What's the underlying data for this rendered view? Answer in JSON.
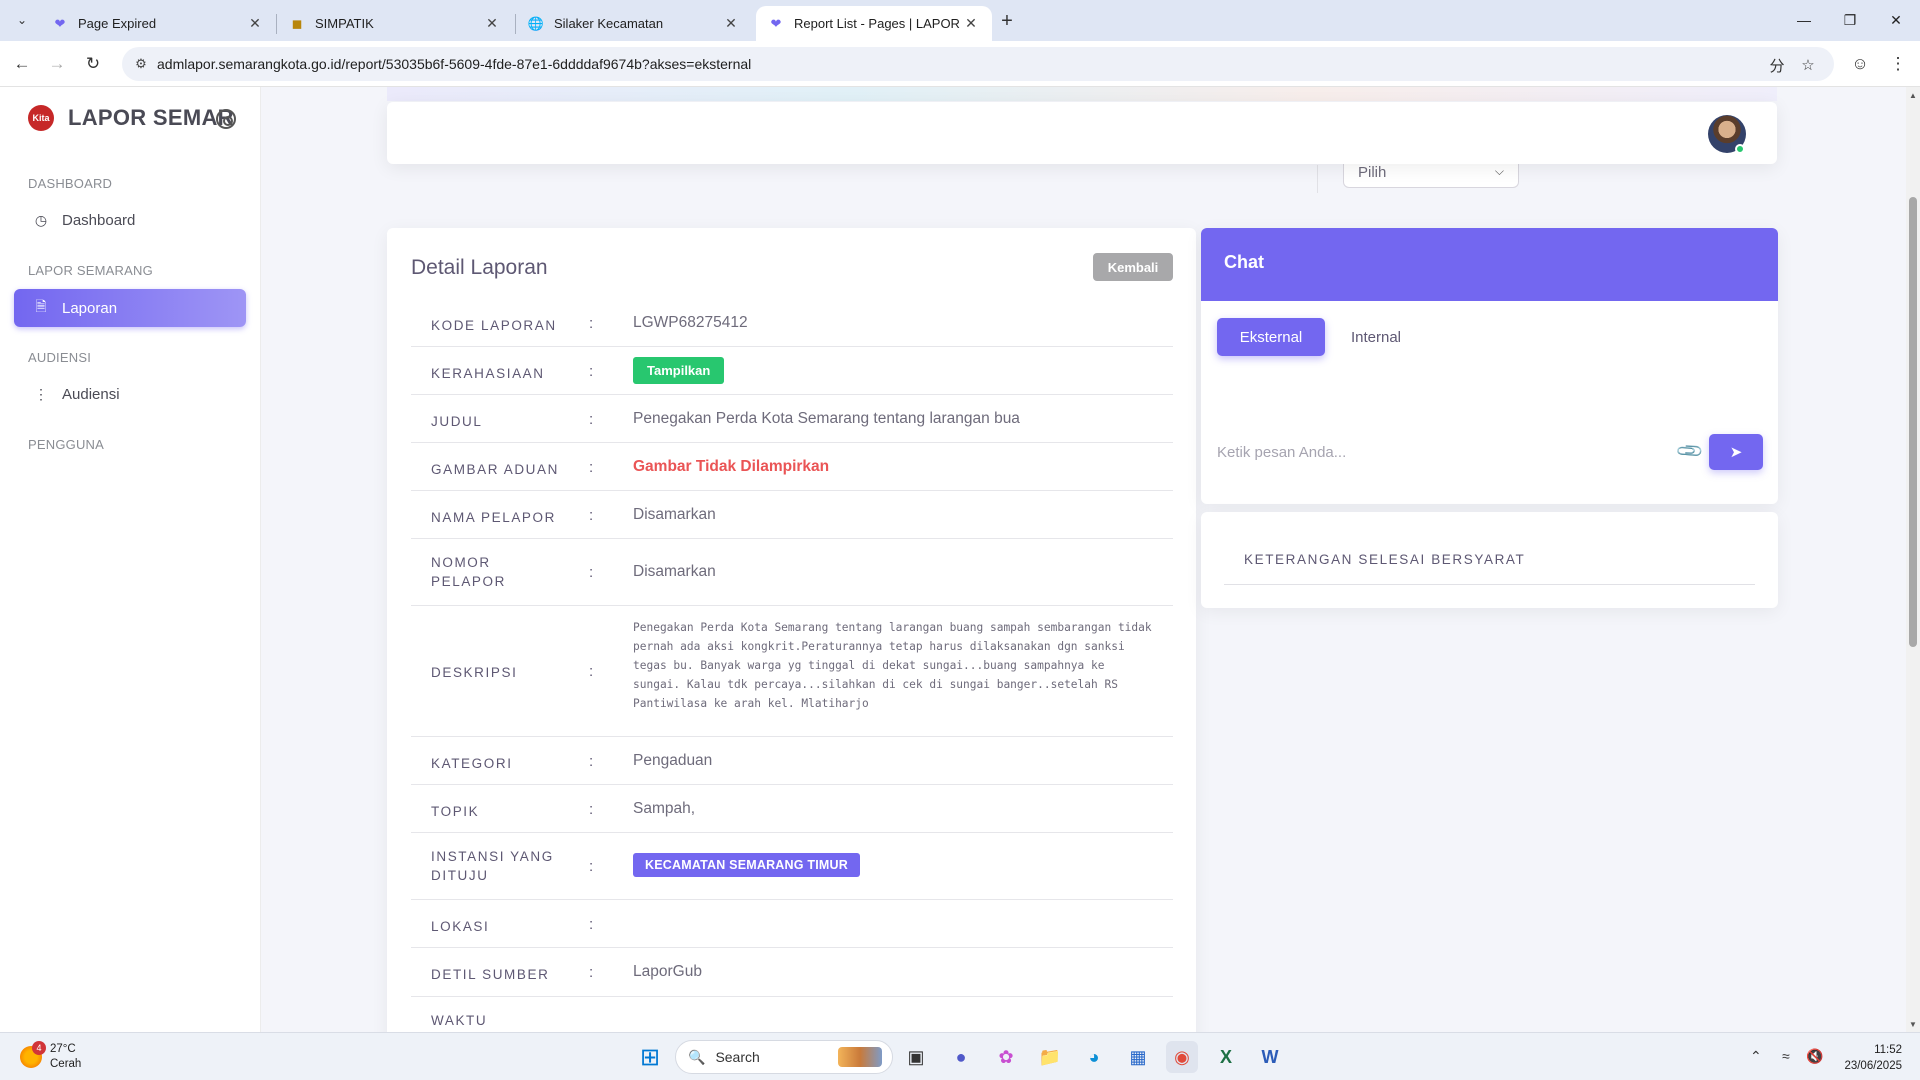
{
  "browser": {
    "tabs": [
      {
        "label": "Page Expired",
        "favicon": "laporsemar-heart-icon"
      },
      {
        "label": "SIMPATIK",
        "favicon": "simpatik-crest-icon"
      },
      {
        "label": "Silaker Kecamatan",
        "favicon": "globe-icon"
      },
      {
        "label": "Report List - Pages | LAPOR SEMARANG",
        "favicon": "laporsemar-heart-icon"
      }
    ],
    "active_tab": 3,
    "url": "admlapor.semarangkota.go.id/report/53035b6f-5609-4fde-87e1-6ddddaf9674b?akses=eksternal"
  },
  "sidebar": {
    "brand": "LAPOR SEMAR",
    "logo_text": "Kita",
    "sections": [
      {
        "header": "DASHBOARD",
        "items": [
          {
            "label": "Dashboard",
            "icon": "gauge-icon"
          }
        ]
      },
      {
        "header": "LAPOR SEMARANG",
        "items": [
          {
            "label": "Laporan",
            "icon": "document-icon",
            "active": true
          }
        ]
      },
      {
        "header": "AUDIENSI",
        "items": [
          {
            "label": "Audiensi",
            "icon": "route-icon"
          }
        ]
      },
      {
        "header": "PENGGUNA",
        "items": []
      }
    ]
  },
  "header": {
    "filter_value": "Pilih"
  },
  "detail": {
    "title": "Detail Laporan",
    "back_label": "Kembali",
    "colon": ":",
    "rows": {
      "kode": {
        "label": "KODE LAPORAN",
        "value": "LGWP68275412"
      },
      "kerahasiaan": {
        "label": "KERAHASIAAN",
        "value": "Tampilkan"
      },
      "judul": {
        "label": "JUDUL",
        "value": "Penegakan Perda Kota Semarang tentang larangan bua"
      },
      "gambar": {
        "label": "GAMBAR ADUAN",
        "value": "Gambar Tidak Dilampirkan"
      },
      "nama": {
        "label": "NAMA PELAPOR",
        "value": "Disamarkan"
      },
      "nomor": {
        "label": "NOMOR PELAPOR",
        "value": "Disamarkan"
      },
      "deskripsi": {
        "label": "DESKRIPSI",
        "value": "Penegakan Perda Kota Semarang tentang larangan buang sampah sembarangan tidak pernah ada aksi kongkrit.Peraturannya tetap harus dilaksanakan dgn sanksi tegas bu. Banyak warga yg tinggal di dekat sungai...buang sampahnya ke sungai. Kalau tdk percaya...silahkan di cek di sungai banger..setelah RS Pantiwilasa ke arah kel. Mlatiharjo"
      },
      "kategori": {
        "label": "KATEGORI",
        "value": "Pengaduan"
      },
      "topik": {
        "label": "TOPIK",
        "value": "Sampah,"
      },
      "instansi": {
        "label": "INSTANSI YANG DITUJU",
        "value": "KECAMATAN SEMARANG TIMUR"
      },
      "lokasi": {
        "label": "LOKASI",
        "value": ""
      },
      "sumber": {
        "label": "DETIL SUMBER",
        "value": "LaporGub"
      },
      "waktu": {
        "label": "WAKTU",
        "value": ""
      }
    }
  },
  "chat": {
    "title": "Chat",
    "tabs": [
      "Eksternal",
      "Internal"
    ],
    "input_placeholder": "Ketik pesan Anda..."
  },
  "keterangan": {
    "title": "KETERANGAN SELESAI BERSYARAT"
  },
  "taskbar": {
    "weather_temp": "27°C",
    "weather_cond": "Cerah",
    "weather_badge": "4",
    "search_label": "Search",
    "time": "11:52",
    "date": "23/06/2025"
  },
  "colors": {
    "primary": "#7367f0",
    "success": "#28c76f",
    "danger": "#ea5455",
    "secondary": "#a8a8aa"
  }
}
